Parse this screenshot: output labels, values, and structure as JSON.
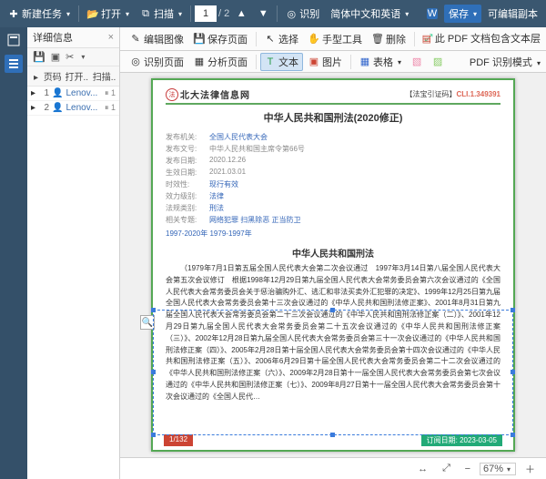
{
  "toolbar": {
    "new_task": "新建任务",
    "open": "打开",
    "scan": "扫描",
    "page_current": "1",
    "page_total": "/ 2",
    "recognize": "识别",
    "lang_select": "简体中文和英语",
    "save": "保存",
    "export": "可编辑副本"
  },
  "side": {
    "title": "详细信息",
    "tabs": {
      "pages": "页码",
      "open": "打开...",
      "scan": "扫描..."
    },
    "rows": [
      {
        "pg": "1",
        "user": "Lenov...",
        "mark": "⏸ 1"
      },
      {
        "pg": "2",
        "user": "Lenov...",
        "mark": "⏸ 1"
      }
    ]
  },
  "ribbon": {
    "edit_image": "编辑图像",
    "save_page": "保存页面",
    "select": "选择",
    "hand": "手型工具",
    "delete": "删除",
    "rec_page": "识别页面",
    "analyze": "分析页面",
    "text": "文本",
    "image": "图片",
    "table": "表格",
    "pdf_note": "此 PDF 文档包含文本层",
    "pdf_mode": "PDF 识别模式"
  },
  "doc": {
    "brand": "北大法律信息网",
    "badge_l": "【法宝引证码】",
    "badge_r": "CLI.1.349391",
    "title": "中华人民共和国刑法(2020修正)",
    "meta": [
      {
        "l": "发布机关:",
        "v": "全国人民代表大会",
        "link": true
      },
      {
        "l": "发布文号:",
        "v": "中华人民共和国主席令第66号",
        "link": false
      },
      {
        "l": "发布日期:",
        "v": "2020.12.26",
        "link": false
      },
      {
        "l": "生效日期:",
        "v": "2021.03.01",
        "link": false
      },
      {
        "l": "时效性:",
        "v": "现行有效",
        "link": true
      },
      {
        "l": "效力级别:",
        "v": "法律",
        "link": true
      },
      {
        "l": "法规类别:",
        "v": "刑法",
        "link": true
      }
    ],
    "tags": "网络犯罪    扫黑除恶    正当防卫",
    "history": "1997-2020年      1979-1997年",
    "subtitle": "中华人民共和国刑法",
    "body": "（1979年7月1日第五届全国人民代表大会第二次会议通过　1997年3月14日第八届全国人民代表大会第五次会议修订　根据1998年12月29日第九届全国人民代表大会常务委员会第六次会议通过的《全国人民代表大会常务委员会关于惩治骗购外汇、逃汇和非法买卖外汇犯罪的决定》、1999年12月25日第九届全国人民代表大会常务委员会第十三次会议通过的《中华人民共和国刑法修正案》、2001年8月31日第九届全国人民代表大会常务委员会第二十三次会议通过的《中华人民共和国刑法修正案（二）》、2001年12月29日第九届全国人民代表大会常务委员会第二十五次会议通过的《中华人民共和国刑法修正案（三）》、2002年12月28日第九届全国人民代表大会常务委员会第三十一次会议通过的《中华人民共和国刑法修正案（四）》、2005年2月28日第十届全国人民代表大会常务委员会第十四次会议通过的《中华人民共和国刑法修正案（五）》、2006年6月29日第十届全国人民代表大会常务委员会第二十二次会议通过的《中华人民共和国刑法修正案（六）》、2009年2月28日第十一届全国人民代表大会常务委员会第七次会议通过的《中华人民共和国刑法修正案（七）》、2009年8月27日第十一届全国人民代表大会常务委员会第十次会议通过的《全国人民代…",
    "footer_l": "1/132",
    "footer_r": "订阅日期: 2023-03-05"
  },
  "reader": {
    "zoom": "67%"
  }
}
